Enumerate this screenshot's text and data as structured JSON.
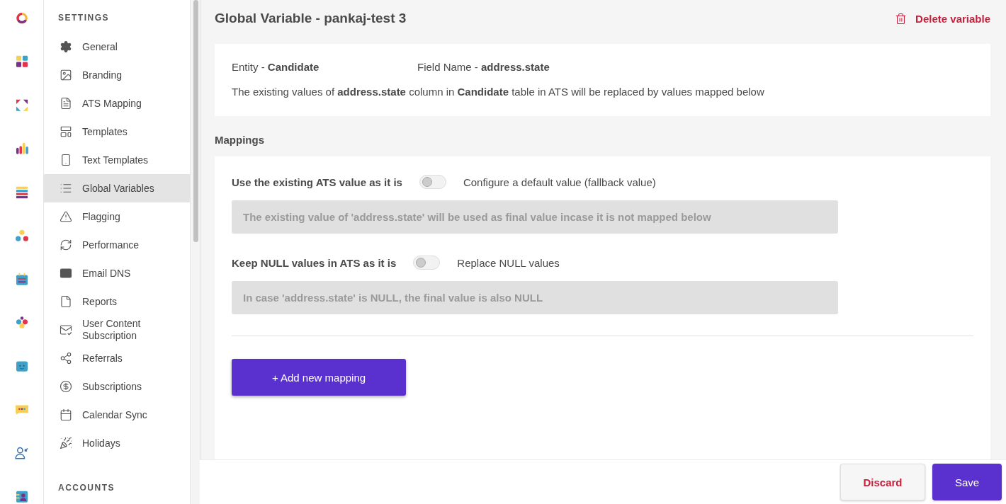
{
  "sidebar": {
    "heading": "SETTINGS",
    "items": [
      {
        "label": "General",
        "selected": false
      },
      {
        "label": "Branding",
        "selected": false
      },
      {
        "label": "ATS Mapping",
        "selected": false
      },
      {
        "label": "Templates",
        "selected": false
      },
      {
        "label": "Text Templates",
        "selected": false
      },
      {
        "label": "Global Variables",
        "selected": true
      },
      {
        "label": "Flagging",
        "selected": false
      },
      {
        "label": "Performance",
        "selected": false
      },
      {
        "label": "Email DNS",
        "selected": false
      },
      {
        "label": "Reports",
        "selected": false
      },
      {
        "label": "User Content Subscription",
        "selected": false
      },
      {
        "label": "Referrals",
        "selected": false
      },
      {
        "label": "Subscriptions",
        "selected": false
      },
      {
        "label": "Calendar Sync",
        "selected": false
      },
      {
        "label": "Holidays",
        "selected": false
      }
    ],
    "section_2": "ACCOUNTS"
  },
  "header": {
    "title": "Global Variable - pankaj-test 3",
    "delete_button": "Delete variable"
  },
  "info": {
    "entity": "Entity - **Candidate**",
    "field_name": "Field Name - **address.state**",
    "description": "The existing values of **address.state** column in **Candidate** table in ATS will be replaced by values mapped below"
  },
  "mappings": {
    "heading": "Mappings",
    "options": [
      {
        "label": "Use the existing ATS value as it is",
        "on": false,
        "alt_label": "Configure a default value (fallback value)",
        "note": "The existing value of 'address.state' will be used as final value incase it is not mapped below"
      },
      {
        "label": "Keep NULL values in ATS as it is",
        "on": false,
        "alt_label": "Replace NULL values",
        "note": "In case 'address.state' is NULL, the final value is also NULL"
      }
    ],
    "add_button": "+ Add new mapping"
  },
  "footer": {
    "buttons": [
      {
        "label": "Discard",
        "kind": "secondary"
      },
      {
        "label": "Save",
        "kind": "primary"
      }
    ]
  }
}
